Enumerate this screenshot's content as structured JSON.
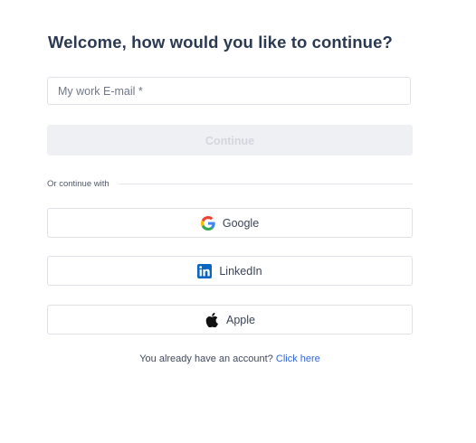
{
  "page": {
    "title": "Welcome, how would you like to continue?"
  },
  "email": {
    "placeholder": "My work E-mail *",
    "value": ""
  },
  "continue_button": {
    "label": "Continue",
    "disabled": true
  },
  "divider": {
    "label": "Or continue with"
  },
  "social": [
    {
      "label": "Google",
      "icon": "google-icon"
    },
    {
      "label": "LinkedIn",
      "icon": "linkedin-icon"
    },
    {
      "label": "Apple",
      "icon": "apple-icon"
    }
  ],
  "footer": {
    "text": "You already have an account?",
    "link_label": "Click here"
  },
  "colors": {
    "title": "#2b3a52",
    "link": "#3466d6",
    "linkedin_brand": "#0a66c2",
    "disabled_button_bg": "#eff0f4"
  }
}
